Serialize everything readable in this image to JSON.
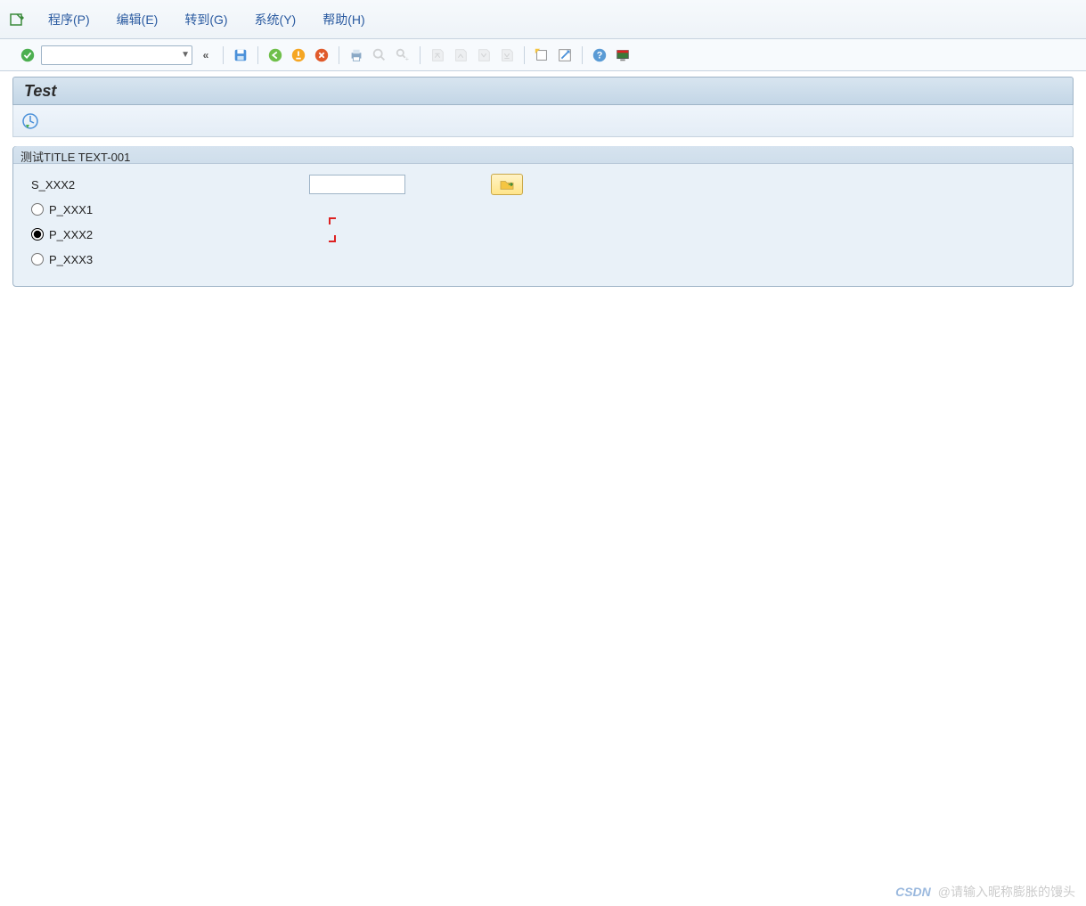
{
  "menu": {
    "items": [
      {
        "label": "程序(P)",
        "underline": "P"
      },
      {
        "label": "编辑(E)",
        "underline": "E"
      },
      {
        "label": "转到(G)",
        "underline": "G"
      },
      {
        "label": "系统(Y)",
        "underline": "Y"
      },
      {
        "label": "帮助(H)",
        "underline": "H"
      }
    ]
  },
  "toolbar": {
    "command_value": "",
    "icons": {
      "ok": "ok-icon",
      "collapse": "collapse-icon",
      "save": "save-icon",
      "back": "back-icon",
      "exit": "exit-icon",
      "cancel": "cancel-icon",
      "print": "print-icon",
      "find": "find-icon",
      "find_next": "find-next-icon",
      "first": "first-page-icon",
      "prev": "prev-page-icon",
      "next": "next-page-icon",
      "last": "last-page-icon",
      "new_session": "new-session-icon",
      "shortcut": "shortcut-icon",
      "help": "help-icon",
      "layout": "layout-icon"
    }
  },
  "title": "Test",
  "subtoolbar": {
    "execute_icon": "execute-icon"
  },
  "group": {
    "title": "测试TITLE TEXT-001",
    "text_field_label": "S_XXX2",
    "text_field_value": "",
    "open_icon": "folder-open-icon",
    "radios": [
      {
        "label": "P_XXX1",
        "checked": false
      },
      {
        "label": "P_XXX2",
        "checked": true
      },
      {
        "label": "P_XXX3",
        "checked": false
      }
    ]
  },
  "footer": {
    "logo_text": "CSDN",
    "watermark": "@请输入昵称膨胀的馒头"
  }
}
